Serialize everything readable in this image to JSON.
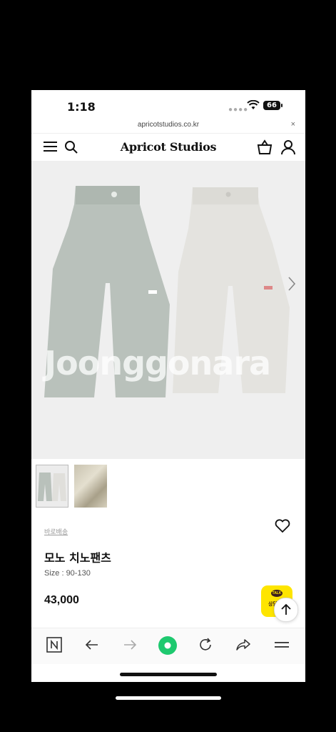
{
  "status_bar": {
    "time": "1:18",
    "battery": "66"
  },
  "browser": {
    "url": "apricotstudios.co.kr",
    "close": "×"
  },
  "site": {
    "logo": "Apricot Studios"
  },
  "gallery": {
    "watermark": "Joonggonara"
  },
  "product": {
    "delivery": "바로배송",
    "name": "모노 치노팬츠",
    "size": "Size : 90-130",
    "price": "43,000"
  },
  "kakao": {
    "bubble": "TALK",
    "label": "상담"
  },
  "colors": {
    "kakao_yellow": "#fee500",
    "toolbar_green": "#1ec96f"
  },
  "toolbar_icons": [
    "naver-icon",
    "back-icon",
    "forward-icon",
    "home-icon",
    "reload-icon",
    "share-icon",
    "menu-icon"
  ]
}
